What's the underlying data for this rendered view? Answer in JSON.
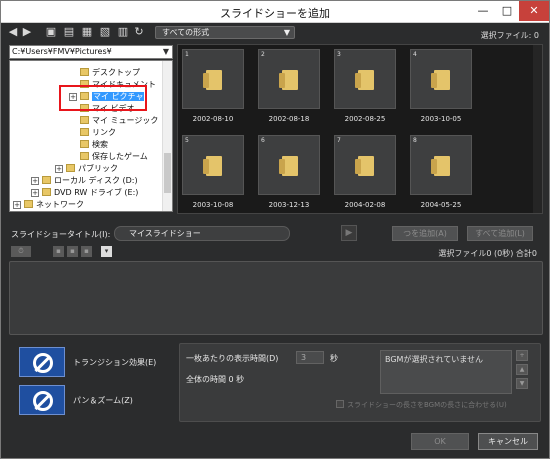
{
  "window": {
    "title": "スライドショーを追加",
    "minimize_glyph": "—",
    "maximize_glyph": "□",
    "close_glyph": "✕"
  },
  "toolbar": {
    "icons": [
      "back-icon",
      "forward-icon",
      "up-folder-icon",
      "view-icon",
      "select-icon",
      "sort-icon",
      "refresh-icon"
    ],
    "format_select": "すべての形式",
    "selected_count": "選択ファイル: 0"
  },
  "folder_path": "C:¥Users¥FMV¥Pictures¥",
  "tree": {
    "items": [
      {
        "label": "デスクトップ"
      },
      {
        "label": "マイドキュメント"
      },
      {
        "label": "マイ ピクチャ",
        "selected": true
      },
      {
        "label": "マイ ビデオ"
      },
      {
        "label": "マイ ミュージック"
      },
      {
        "label": "リンク"
      },
      {
        "label": "検索"
      },
      {
        "label": "保存したゲーム"
      },
      {
        "label": "パブリック"
      },
      {
        "label": "ローカル ディスク (D:)"
      },
      {
        "label": "DVD RW ドライブ (E:)"
      },
      {
        "label": "ネットワーク"
      }
    ]
  },
  "thumbnails": [
    {
      "num": "1",
      "date": "2002-08-10"
    },
    {
      "num": "2",
      "date": "2002-08-18"
    },
    {
      "num": "3",
      "date": "2002-08-25"
    },
    {
      "num": "4",
      "date": "2003-10-05"
    },
    {
      "num": "5",
      "date": "2003-10-08"
    },
    {
      "num": "6",
      "date": "2003-12-13"
    },
    {
      "num": "7",
      "date": "2004-02-08"
    },
    {
      "num": "8",
      "date": "2004-05-25"
    }
  ],
  "slideshow": {
    "title_label": "スライドショータイトル(I):",
    "title_value": "マイスライドショー",
    "play_glyph": "▶",
    "add_label": "つを追加(A)",
    "add_all_label": "すべて追加(L)",
    "selected_files": "選択ファイル0 (0秒) 合計0"
  },
  "effects": {
    "transition_label": "トランジション効果(E)",
    "panzoom_label": "パン＆ズーム(Z)"
  },
  "settings": {
    "per_slide_label": "一枚あたりの表示時間(D)",
    "per_slide_value": "3",
    "seconds_unit": "秒",
    "total_time": "全体の時間 0 秒",
    "bgm_status": "BGMが選択されていません",
    "bgm_checkbox_label": "スライドショーの長さをBGMの長さに合わせる(U)"
  },
  "buttons": {
    "ok": "OK",
    "cancel": "キャンセル"
  }
}
